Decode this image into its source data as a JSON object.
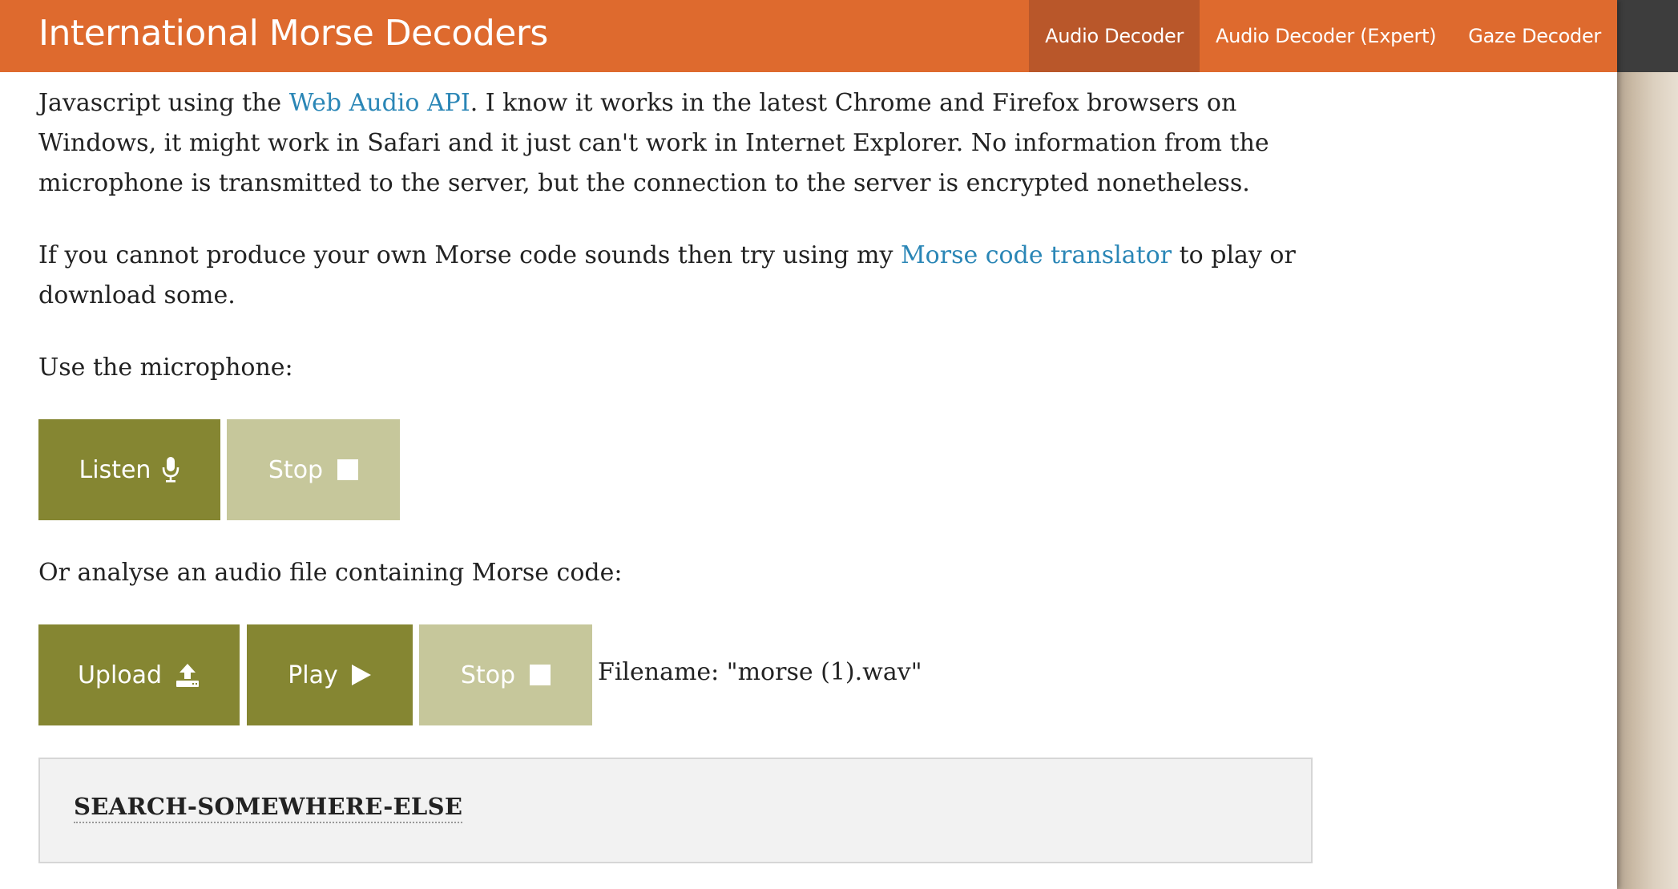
{
  "site_title": "International Morse Decoders",
  "nav": [
    {
      "label": "Audio Decoder",
      "active": true
    },
    {
      "label": "Audio Decoder (Expert)",
      "active": false
    },
    {
      "label": "Gaze Decoder",
      "active": false
    }
  ],
  "content": {
    "p1": {
      "before_link": "Javascript using the ",
      "link": "Web Audio API",
      "after_link": ". I know it works in the latest Chrome and Firefox browsers on Windows, it might work in Safari and it just can't work in Internet Explorer. No information from the microphone is transmitted to the server, but the connection to the server is encrypted nonetheless."
    },
    "p2": {
      "before_link": "If you cannot produce your own Morse code sounds then try using my ",
      "link": "Morse code translator",
      "after_link": " to play or download some."
    },
    "mic_label": "Use the microphone:",
    "file_label": "Or analyse an audio file containing Morse code:",
    "filename": "Filename: \"morse (1).wav\""
  },
  "buttons": {
    "listen": "Listen",
    "mic_stop": "Stop",
    "upload": "Upload",
    "play": "Play",
    "file_stop": "Stop"
  },
  "search_label": "SEARCH-SOMEWHERE-ELSE",
  "icons": {
    "listen": "microphone-icon",
    "stop": "stop-square-icon",
    "upload": "upload-icon",
    "play": "play-triangle-icon"
  },
  "colors": {
    "header": "#de6a2e",
    "nav_active": "#b9572a",
    "button_primary": "#858632",
    "button_disabled": "#c6c79b",
    "link": "#2a86b6"
  }
}
